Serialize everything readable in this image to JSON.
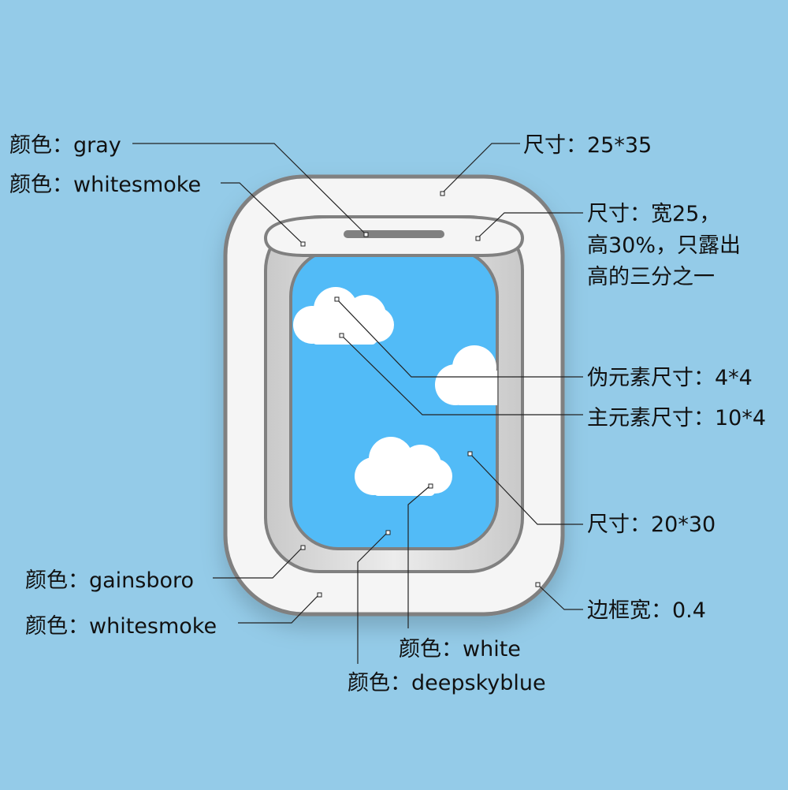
{
  "colors": {
    "background": "#94cbe8",
    "frame": "#f5f5f5",
    "frame_border": "#808080",
    "shade": "#dcdcdc",
    "sky": "#52bbf7",
    "cloud": "#ffffff",
    "handle": "#808080"
  },
  "annotations": {
    "handle_color": "颜色：gray",
    "shade_color": "颜色：whitesmoke",
    "window_size": "尺寸：25*35",
    "shade_size_line1": "尺寸：宽25，",
    "shade_size_line2": "高30%，只露出",
    "shade_size_line3": "高的三分之一",
    "pseudo_size": "伪元素尺寸：4*4",
    "main_size": "主元素尺寸：10*4",
    "sky_size": "尺寸：20*30",
    "inner_frame_color": "颜色：gainsboro",
    "outer_frame_color": "颜色：whitesmoke",
    "border_width": "边框宽：0.4",
    "cloud_color": "颜色：white",
    "sky_color": "颜色：deepskyblue"
  }
}
